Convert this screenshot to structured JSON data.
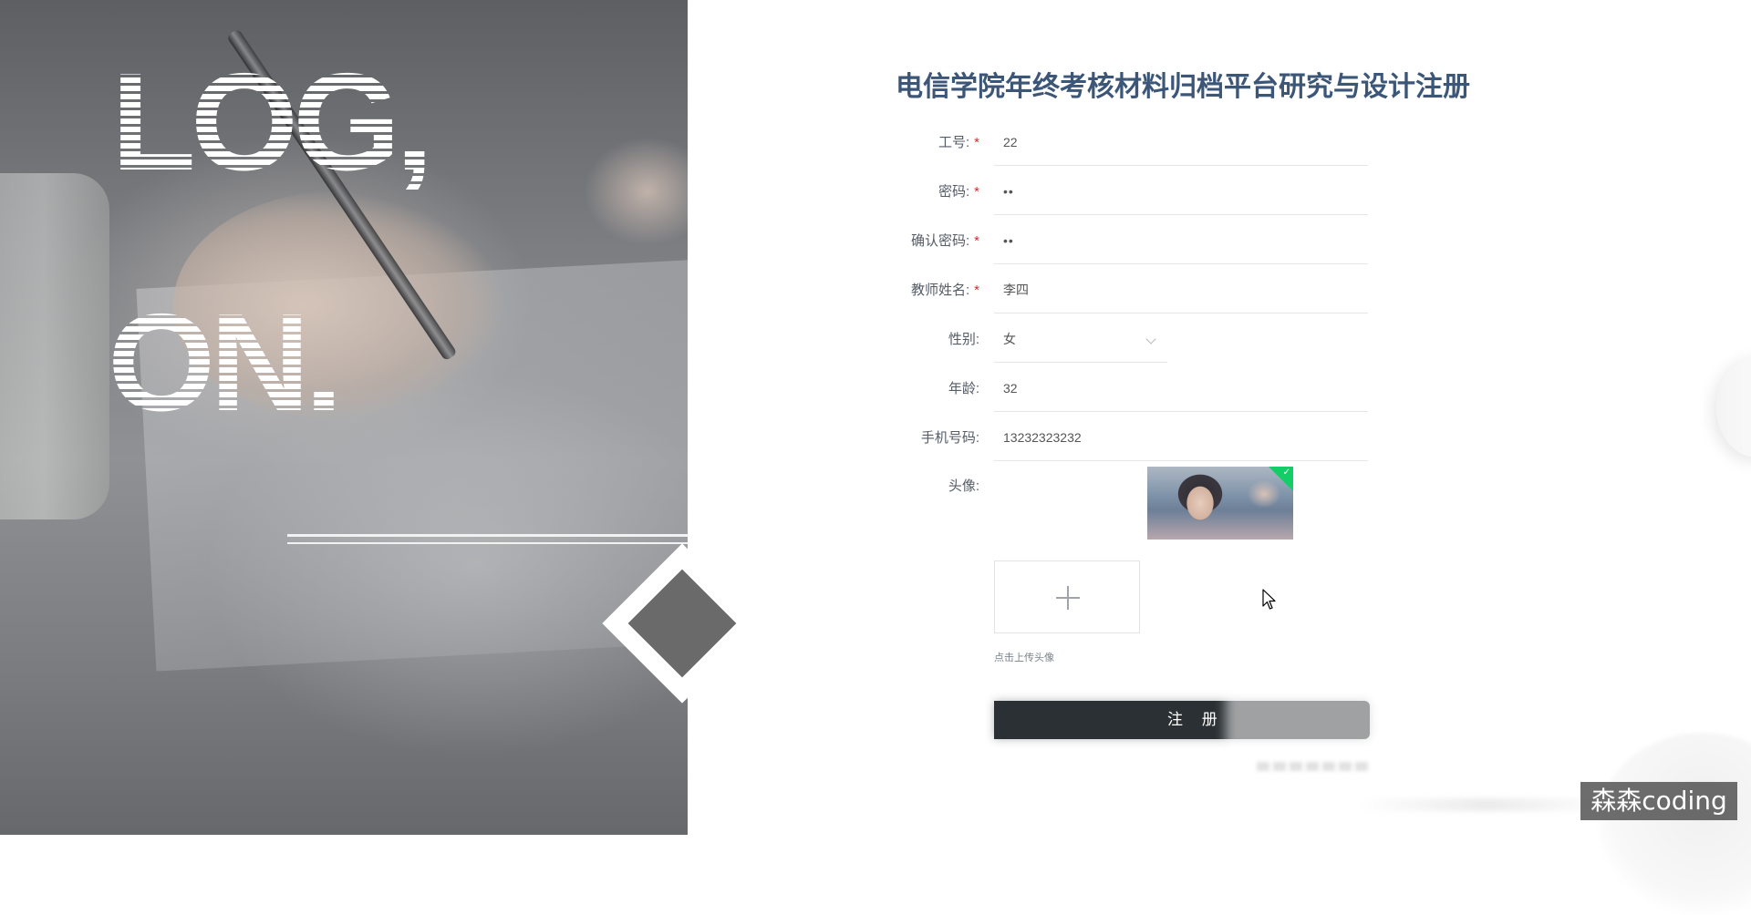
{
  "hero": {
    "word1": "LOG,",
    "word2": "ON."
  },
  "page": {
    "title": "电信学院年终考核材料归档平台研究与设计注册"
  },
  "form": {
    "fields": [
      {
        "label": "工号:",
        "required": true,
        "value": "22",
        "type": "text"
      },
      {
        "label": "密码:",
        "required": true,
        "value": "••",
        "type": "password"
      },
      {
        "label": "确认密码:",
        "required": true,
        "value": "••",
        "type": "password"
      },
      {
        "label": "教师姓名:",
        "required": true,
        "value": "李四",
        "type": "text"
      },
      {
        "label": "性别:",
        "required": false,
        "value": "女",
        "type": "select"
      },
      {
        "label": "年龄:",
        "required": false,
        "value": "32",
        "type": "text"
      },
      {
        "label": "手机号码:",
        "required": false,
        "value": "13232323232",
        "type": "text"
      }
    ],
    "required_mark": "*",
    "avatar_label": "头像:",
    "upload_hint": "点击上传头像",
    "submit_label": "注 册"
  },
  "watermark": "森森coding",
  "icons": {
    "upload": "plus-icon",
    "select": "chevron-down-icon",
    "uploaded": "check-icon",
    "pointer": "cursor-icon"
  },
  "colors": {
    "title": "#3c5678",
    "required": "#e0262d",
    "button_bg": "#2b3034",
    "success_badge": "#13ce66",
    "hero_bg": "#7c7e82"
  }
}
